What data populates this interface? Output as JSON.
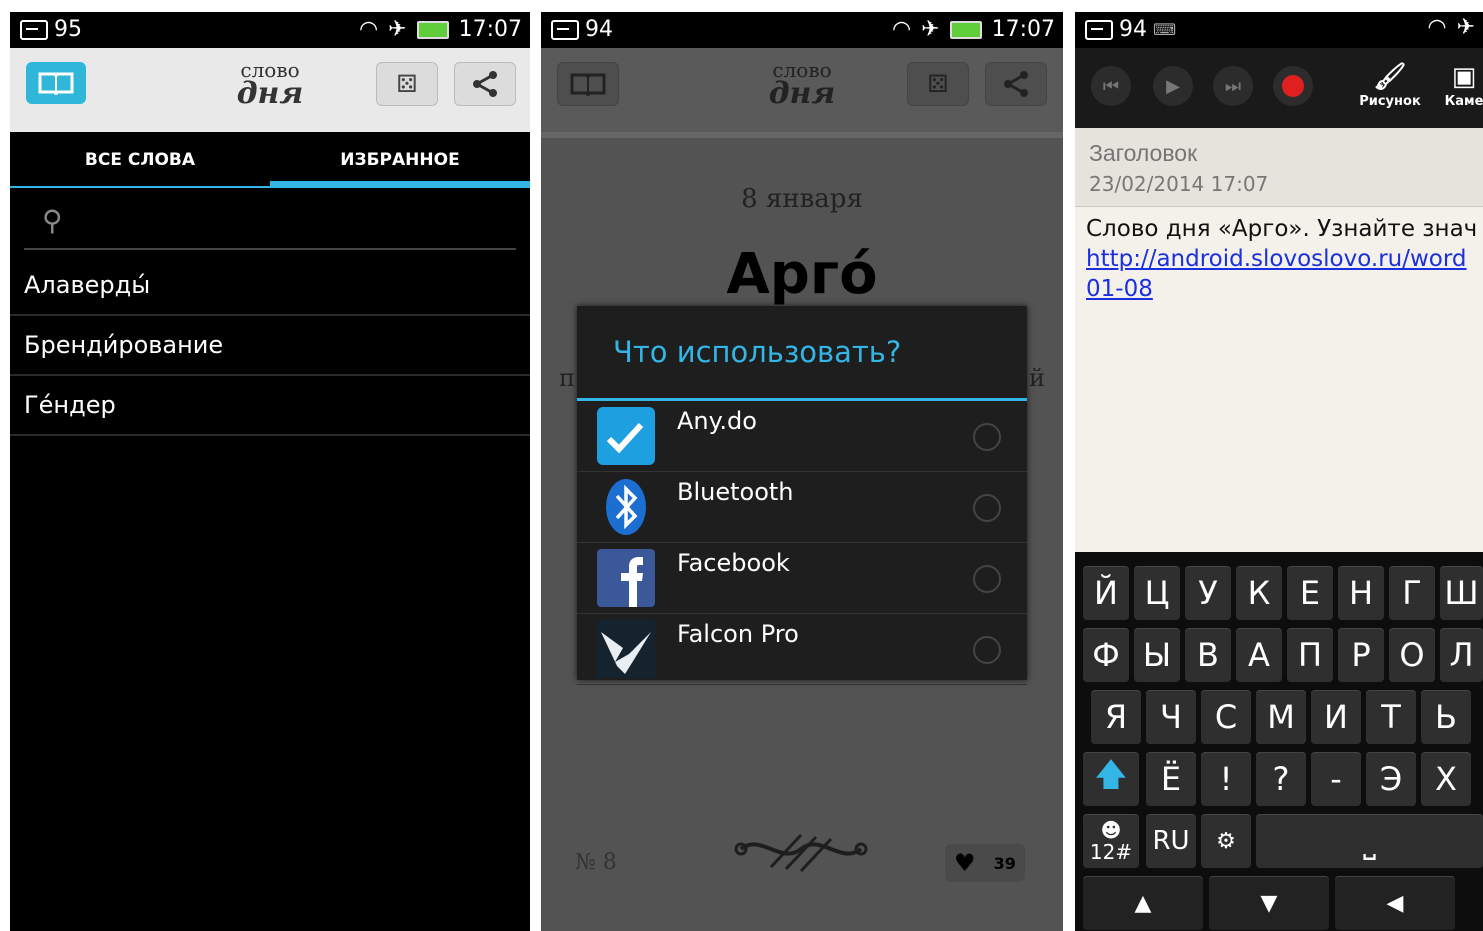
{
  "screen1": {
    "status": {
      "notif_count": "95",
      "time": "17:07"
    },
    "app_logo": {
      "line1": "слово",
      "line2": "дня"
    },
    "tabs": [
      {
        "label": "ВСЕ СЛОВА"
      },
      {
        "label": "ИЗБРАННОЕ"
      }
    ],
    "search": {
      "value": "",
      "placeholder": ""
    },
    "words": [
      "Алаверды́",
      "Бренди́рование",
      "Ге́ндер"
    ]
  },
  "screen2": {
    "status": {
      "notif_count": "94",
      "time": "17:07"
    },
    "app_logo": {
      "line1": "слово",
      "line2": "дня"
    },
    "date": "8 января",
    "word": "Арго́",
    "dialog": {
      "title": "Что использовать?",
      "options": [
        {
          "label": "Any.do",
          "icon": "anydo-icon"
        },
        {
          "label": "Bluetooth",
          "icon": "bluetooth-icon"
        },
        {
          "label": "Facebook",
          "icon": "facebook-icon"
        },
        {
          "label": "Falcon Pro",
          "icon": "falcon-pro-icon"
        }
      ]
    },
    "number": "№ 8",
    "likes": "39",
    "side_left": "п",
    "side_right": "й"
  },
  "screen3": {
    "status": {
      "notif_count": "94"
    },
    "toolbar": {
      "draw_label": "Рисунок",
      "camera_label": "Каме"
    },
    "note": {
      "title_placeholder": "Заголовок",
      "timestamp": "23/02/2014 17:07",
      "line1": "Слово дня «Арго». Узнайте знач",
      "link_part1": "http://android.slovoslovo.ru/word",
      "link_part2": "01-08"
    },
    "keyboard": {
      "row1": [
        "Й",
        "Ц",
        "У",
        "К",
        "Е",
        "Н",
        "Г",
        "Ш"
      ],
      "row2": [
        "Ф",
        "Ы",
        "В",
        "А",
        "П",
        "Р",
        "О",
        "Л"
      ],
      "row3": [
        "Я",
        "Ч",
        "С",
        "М",
        "И",
        "Т",
        "Ь"
      ],
      "row4": [
        "Ё",
        "!",
        "?",
        "-",
        "Э",
        "Х"
      ],
      "num_key": "12#",
      "lang_key": "RU"
    }
  },
  "colors": {
    "accent": "#33b5e5",
    "record": "#e02020",
    "link": "#1a2fe0"
  }
}
